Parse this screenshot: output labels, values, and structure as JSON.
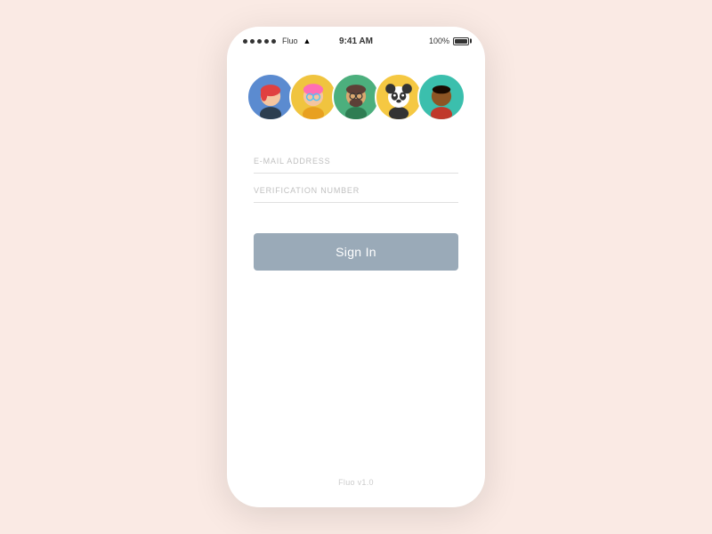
{
  "statusBar": {
    "carrier": "Fluo",
    "time": "9:41 AM",
    "battery": "100%"
  },
  "avatars": [
    {
      "id": 1,
      "emoji": "👩‍🦰",
      "bg": "#5b8bd0",
      "label": "avatar-girl-red"
    },
    {
      "id": 2,
      "emoji": "🧑‍🎤",
      "bg": "#f0c43f",
      "label": "avatar-person-glasses"
    },
    {
      "id": 3,
      "emoji": "🧔",
      "bg": "#4caf7d",
      "label": "avatar-man-beard"
    },
    {
      "id": 4,
      "emoji": "🐼",
      "bg": "#f5c842",
      "label": "avatar-panda"
    },
    {
      "id": 5,
      "emoji": "🧑",
      "bg": "#3bbfad",
      "label": "avatar-man-dark"
    }
  ],
  "form": {
    "emailPlaceholder": "E-MAIL ADDRESS",
    "verificationPlaceholder": "VERIFICATION NUMBER"
  },
  "button": {
    "signIn": "Sign In"
  },
  "footer": {
    "version": "Fluo v1.0"
  }
}
